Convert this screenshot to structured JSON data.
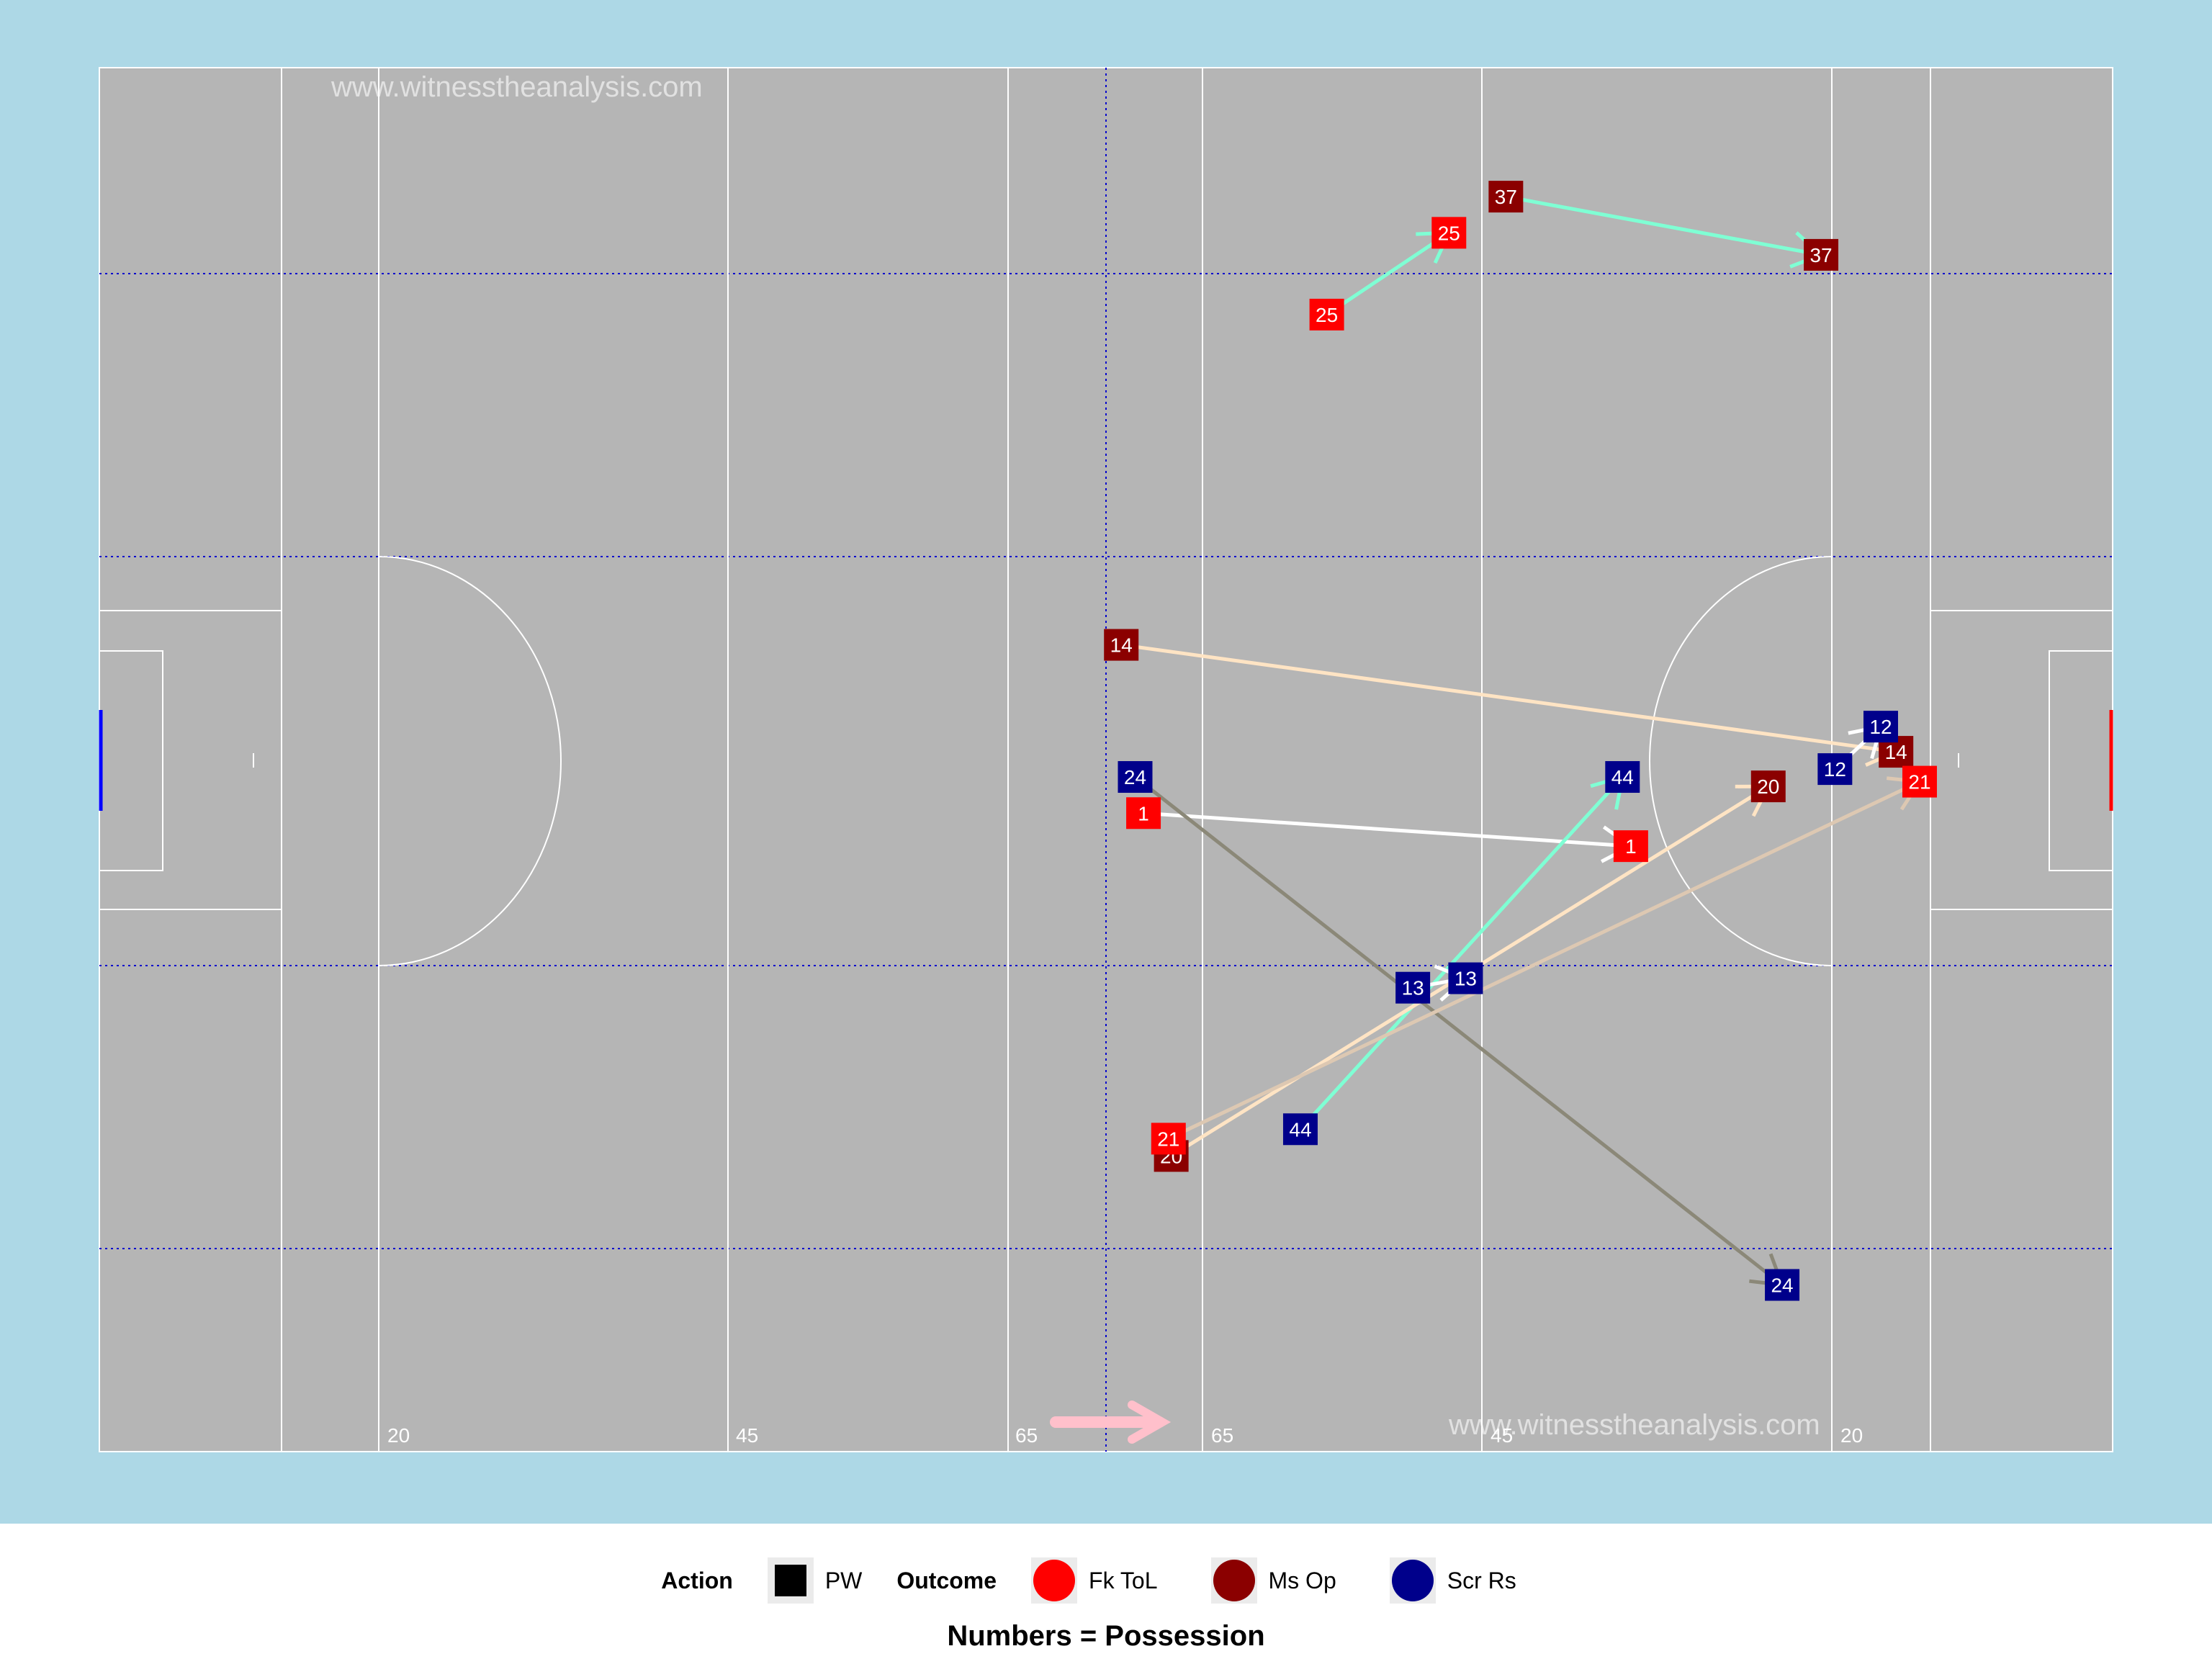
{
  "watermark_top": "www.witnesstheanalysis.com",
  "watermark_bottom": "www.witnesstheanalysis.com",
  "pitch_markings": [
    "20",
    "45",
    "65",
    "65",
    "45",
    "20"
  ],
  "legend": {
    "action_title": "Action",
    "action_items": [
      {
        "label": "PW",
        "color": "#000000"
      }
    ],
    "outcome_title": "Outcome",
    "outcome_items": [
      {
        "label": "Fk ToL",
        "color": "#ff0000"
      },
      {
        "label": "Ms Op",
        "color": "#8b0000"
      },
      {
        "label": "Scr Rs",
        "color": "#00008b"
      }
    ]
  },
  "caption": "Numbers = Possession",
  "colors": {
    "background": "#add8e6",
    "pitch": "#b5b5b5",
    "lines": "#ffffff",
    "grid_dotted": "#0000cd",
    "Fk ToL": "#ff0000",
    "Ms Op": "#8b0000",
    "Scr Rs": "#00008b",
    "attack_arrow": "#ffc0cb"
  },
  "chart_data": {
    "type": "scatter",
    "description_free": true,
    "x_range": [
      0,
      145
    ],
    "y_range": [
      0,
      88
    ],
    "events": [
      {
        "possession": "25",
        "outcome": "Fk ToL",
        "from": [
          88.4,
          72.3
        ],
        "to": [
          97.2,
          77.5
        ],
        "line_color": "#7fffd4"
      },
      {
        "possession": "37",
        "outcome": "Ms Op",
        "from": [
          101.3,
          79.8
        ],
        "to": [
          124.0,
          76.1
        ],
        "line_color": "#7fffd4"
      },
      {
        "possession": "14",
        "outcome": "Ms Op",
        "from": [
          73.6,
          51.3
        ],
        "to": [
          129.4,
          44.5
        ],
        "line_color": "#ffe4c4"
      },
      {
        "possession": "12",
        "outcome": "Scr Rs",
        "from": [
          125.0,
          43.4
        ],
        "to": [
          128.3,
          46.1
        ],
        "line_color": "#ffffff"
      },
      {
        "possession": "1",
        "outcome": "Fk ToL",
        "from": [
          75.2,
          40.6
        ],
        "to": [
          110.3,
          38.5
        ],
        "line_color": "#ffffff"
      },
      {
        "possession": "24",
        "outcome": "Scr Rs",
        "from": [
          74.6,
          42.9
        ],
        "to": [
          121.2,
          10.6
        ],
        "line_color": "#8b8878"
      },
      {
        "possession": "44",
        "outcome": "Scr Rs",
        "from": [
          86.5,
          20.5
        ],
        "to": [
          109.7,
          42.9
        ],
        "line_color": "#7fffd4"
      },
      {
        "possession": "13",
        "outcome": "Scr Rs",
        "from": [
          94.6,
          29.5
        ],
        "to": [
          98.4,
          30.1
        ],
        "line_color": "#ffffff"
      },
      {
        "possession": "20",
        "outcome": "Ms Op",
        "from": [
          77.2,
          18.8
        ],
        "to": [
          120.2,
          42.3
        ],
        "line_color": "#ffe4c4"
      },
      {
        "possession": "21",
        "outcome": "Fk ToL",
        "from": [
          77.0,
          19.9
        ],
        "to": [
          131.1,
          42.6
        ],
        "line_color": "#ddc8b2"
      }
    ]
  }
}
